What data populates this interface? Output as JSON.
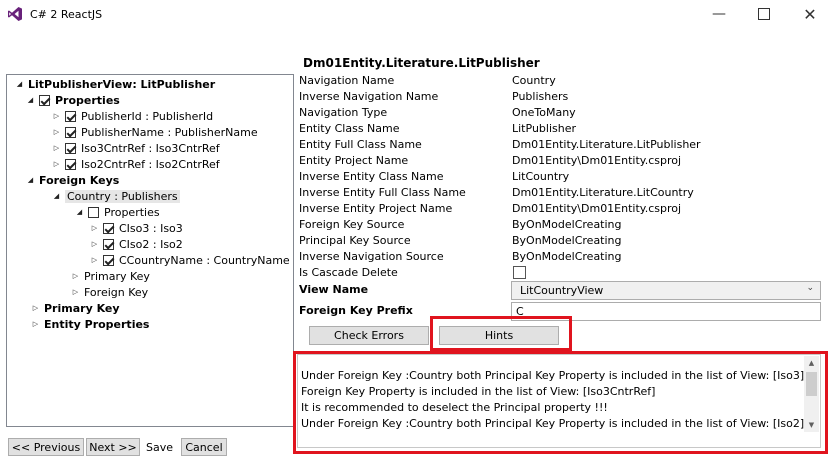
{
  "window": {
    "title": "C# 2 ReactJS",
    "icon": "visual-studio-icon",
    "controls": [
      "minimize-icon",
      "maximize-icon",
      "close-icon"
    ]
  },
  "tree": {
    "root": "LitPublisherView: LitPublisher",
    "properties": "Properties",
    "property_items": [
      "PublisherId : PublisherId",
      "PublisherName : PublisherName",
      "Iso3CntrRef : Iso3CntrRef",
      "Iso2CntrRef : Iso2CntrRef"
    ],
    "foreign_keys": "Foreign Keys",
    "country": "Country : Publishers",
    "fk_properties": "Properties",
    "fk_property_items": [
      "CIso3 : Iso3",
      "CIso2 : Iso2",
      "CCountryName : CountryName"
    ],
    "fk_primary_key": "Primary Key",
    "fk_foreign_key": "Foreign Key",
    "primary_key": "Primary Key",
    "entity_properties": "Entity Properties"
  },
  "footer": {
    "previous": "<< Previous",
    "next": "Next >>",
    "save": "Save",
    "cancel": "Cancel"
  },
  "details": {
    "title": "Dm01Entity.Literature.LitPublisher",
    "rows": [
      {
        "label": "Navigation Name",
        "value": "Country"
      },
      {
        "label": "Inverse Navigation Name",
        "value": "Publishers"
      },
      {
        "label": "Navigation Type",
        "value": "OneToMany"
      },
      {
        "label": "Entity Class Name",
        "value": "LitPublisher"
      },
      {
        "label": "Entity Full Class Name",
        "value": "Dm01Entity.Literature.LitPublisher"
      },
      {
        "label": "Entity Project Name",
        "value": "Dm01Entity\\Dm01Entity.csproj"
      },
      {
        "label": "Inverse Entity Class Name",
        "value": "LitCountry"
      },
      {
        "label": "Inverse Entity Full Class Name",
        "value": "Dm01Entity.Literature.LitCountry"
      },
      {
        "label": "Inverse Entity Project Name",
        "value": "Dm01Entity\\Dm01Entity.csproj"
      },
      {
        "label": "Foreign Key Source",
        "value": "ByOnModelCreating"
      },
      {
        "label": "Principal Key Source",
        "value": "ByOnModelCreating"
      },
      {
        "label": "Inverse Navigation Source",
        "value": "ByOnModelCreating"
      }
    ],
    "cascade_label": "Is Cascade Delete",
    "view_name_label": "View Name",
    "view_name_value": "LitCountryView",
    "fk_prefix_label": "Foreign Key Prefix",
    "fk_prefix_value": "C",
    "check_errors": "Check Errors",
    "hints": "Hints"
  },
  "messages": [
    "Under Foreign Key :Country  both Principal Key Property is included in the list of View: [Iso3]",
    "Foreign Key Property is included in the list of View: [Iso3CntrRef]",
    "It is recommended to deselect the Principal property !!!",
    "Under Foreign Key :Country  both Principal Key Property is included in the list of View: [Iso2]"
  ],
  "colors": {
    "highlight": "#e0141e",
    "icon": "#68217a"
  }
}
